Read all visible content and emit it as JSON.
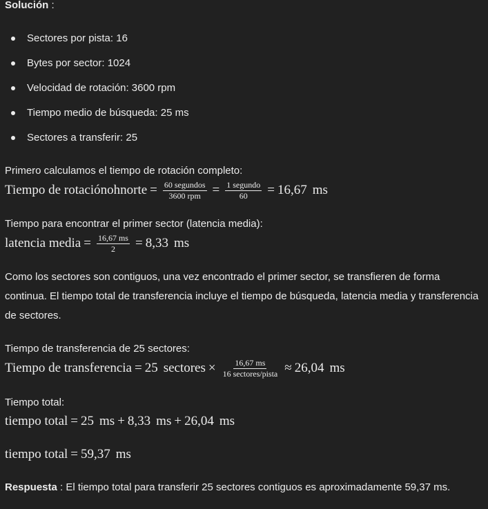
{
  "heading": "Solución",
  "heading_colon": " :",
  "list": [
    "Sectores por pista: 16",
    "Bytes por sector: 1024",
    "Velocidad de rotación: 3600 rpm",
    "Tiempo medio de búsqueda: 25 ms",
    "Sectores a transferir: 25"
  ],
  "step1": {
    "text": "Primero calculamos el tiempo de rotación completo:",
    "lhs": "Tiempo de rotaciónohnorte",
    "f1_num": "60 segundos",
    "f1_den": "3600 rpm",
    "f2_num": "1 segundo",
    "f2_den": "60",
    "result": "16,67",
    "unit": "ms"
  },
  "step2": {
    "text": "Tiempo para encontrar el primer sector (latencia media):",
    "lhs": "latencia media",
    "f_num": "16,67 ms",
    "f_den": "2",
    "result": "8,33",
    "unit": "ms"
  },
  "paragraph": "Como los sectores son contiguos, una vez encontrado el primer sector, se transfieren de forma continua. El tiempo total de transferencia incluye el tiempo de búsqueda, latencia media y transferencia de sectores.",
  "step3": {
    "text": "Tiempo de transferencia de 25 sectores:",
    "lhs": "Tiempo de transferencia",
    "n": "25",
    "sectores": "sectores",
    "f_num": "16,67 ms",
    "f_den": "16 sectores/pista",
    "result": "26,04",
    "unit": "ms"
  },
  "step4": {
    "text": "Tiempo total:",
    "lhs": "tiempo total",
    "a": "25",
    "b": "8,33",
    "c": "26,04",
    "unit": "ms"
  },
  "step5": {
    "lhs": "tiempo total",
    "result": "59,37",
    "unit": "ms"
  },
  "answer": {
    "label": "Respuesta",
    "text": " : El tiempo total para transferir 25 sectores contiguos es aproximadamente 59,37 ms."
  }
}
